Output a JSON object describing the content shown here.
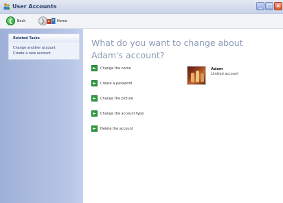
{
  "window": {
    "title": "User Accounts",
    "controls": {
      "minimize_glyph": "_",
      "maximize_glyph": "□",
      "close_glyph": "×"
    }
  },
  "toolbar": {
    "back_label": "Back",
    "home_label": "Home",
    "back_icon": "back-arrow-icon",
    "forward_icon": "forward-arrow-icon",
    "home_icon": "home-icon"
  },
  "sidebar": {
    "section_title": "Related Tasks",
    "links": [
      {
        "label": "Change another account"
      },
      {
        "label": "Create a new account"
      }
    ]
  },
  "main": {
    "heading": "What do you want to change about Adam's account?",
    "options": [
      {
        "label": "Change the name",
        "icon": "green-arrow-icon"
      },
      {
        "label": "Create a password",
        "icon": "green-arrow-icon"
      },
      {
        "label": "Change the picture",
        "icon": "green-arrow-icon"
      },
      {
        "label": "Change the account type",
        "icon": "green-arrow-icon"
      },
      {
        "label": "Delete the account",
        "icon": "green-arrow-icon"
      }
    ]
  },
  "user": {
    "name": "Adam",
    "account_type": "Limited account"
  },
  "colors": {
    "heading": "#8d9bb7",
    "sidebar": "#aebde1",
    "accent_green": "#2b9c3f"
  }
}
